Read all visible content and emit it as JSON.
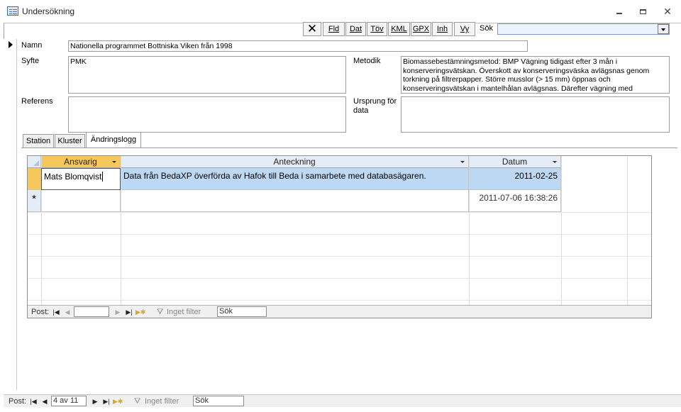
{
  "window": {
    "title": "Undersökning"
  },
  "toolbar": {
    "close_glyph": "✕",
    "buttons": [
      "Fld",
      "Dat",
      "Töv",
      "KML",
      "GPX",
      "Inh",
      "Vy"
    ],
    "search_label": "Sök",
    "search_value": ""
  },
  "form": {
    "namn_label": "Namn",
    "namn_value": "Nationella programmet Bottniska Viken från 1998",
    "syfte_label": "Syfte",
    "syfte_value": "PMK",
    "referens_label": "Referens",
    "referens_value": "",
    "metodik_label": "Metodik",
    "metodik_value": "Biomassebestämningsmetod: BMP Vägning tidigast efter 3 mån i konserveringsvätskan. Överskott av konserveringsväska avlägsnas genom torkning på filtrerpapper. Större musslor (> 15 mm) öppnas och konserveringsvätskan i mantelhålan avlägsnas. Därefter vägning med",
    "ursprung_label": "Ursprung för data",
    "ursprung_value": ""
  },
  "tabs": [
    {
      "label": "Station",
      "active": false
    },
    {
      "label": "Kluster",
      "active": false
    },
    {
      "label": "Ändringslogg",
      "active": true
    }
  ],
  "datasheet": {
    "columns": [
      "Ansvarig",
      "Anteckning",
      "Datum"
    ],
    "rows": [
      {
        "ansvarig": "Mats Blomqvist",
        "anteckning": "Data  från BedaXP överförda av Hafok till Beda i samarbete med databasägaren.",
        "datum": "2011-02-25"
      }
    ],
    "new_row_marker": "*",
    "new_row_datum": "2011-07-06 16:38:26"
  },
  "subnav": {
    "post_label": "Post:",
    "record_value": "",
    "filter_label": "Inget filter",
    "search_label": "Sök"
  },
  "mainnav": {
    "post_label": "Post:",
    "record_value": "4 av 11",
    "filter_label": "Inget filter",
    "search_label": "Sök"
  }
}
